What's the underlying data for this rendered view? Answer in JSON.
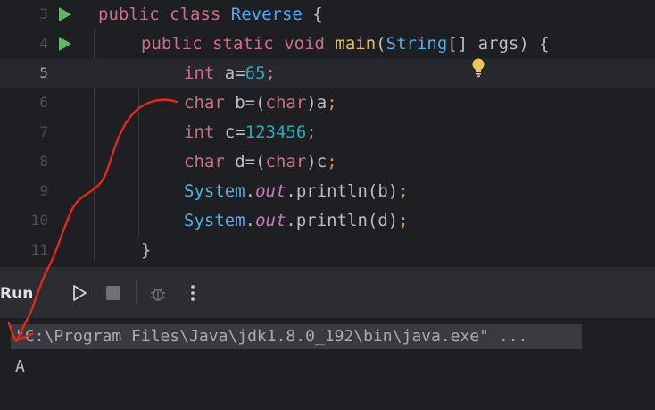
{
  "editor": {
    "lines": [
      {
        "num": "3"
      },
      {
        "num": "4"
      },
      {
        "num": "5"
      },
      {
        "num": "6"
      },
      {
        "num": "7"
      },
      {
        "num": "8"
      },
      {
        "num": "9"
      },
      {
        "num": "10"
      },
      {
        "num": "11"
      }
    ],
    "code": {
      "l3_public": "public",
      "l3_class": "class",
      "l3_name": "Reverse",
      "l3_brace": " {",
      "l4_public": "public",
      "l4_static": "static",
      "l4_void": "void",
      "l4_main": "main",
      "l4_open": "(",
      "l4_string": "String",
      "l4_rest": "[] args) {",
      "l5_int": "int",
      "l5_a": " a=",
      "l5_num": "65",
      "l5_semi": ";",
      "l6_char": "char",
      "l6_b": " b=(",
      "l6_cast": "char",
      "l6_rest": ")a",
      "l6_semi": ";",
      "l7_int": "int",
      "l7_c": " c=",
      "l7_num": "123456",
      "l7_semi": ";",
      "l8_char": "char",
      "l8_d": " d=(",
      "l8_cast": "char",
      "l8_rest": ")c",
      "l8_semi": ";",
      "l9_sys": "System",
      "l9_dot": ".",
      "l9_out": "out",
      "l9_call": ".println(b)",
      "l9_semi": ";",
      "l10_sys": "System",
      "l10_dot": ".",
      "l10_out": "out",
      "l10_call": ".println(d)",
      "l10_semi": ";",
      "l11_brace": "}"
    }
  },
  "run_panel": {
    "title": "Run",
    "icons": [
      "rerun-icon",
      "stop-icon",
      "debug-icon",
      "more-options-icon"
    ]
  },
  "console": {
    "command": "\"C:\\Program Files\\Java\\jdk1.8.0_192\\bin\\java.exe\" ...",
    "output": "A"
  },
  "colors": {
    "background": "#1e1f22",
    "keyword": "#cf6e89",
    "class_name": "#56a8f5",
    "method": "#e8ba63",
    "number": "#2aacb8",
    "run_arrow": "#5fb865",
    "annotation": "#e8261a"
  }
}
